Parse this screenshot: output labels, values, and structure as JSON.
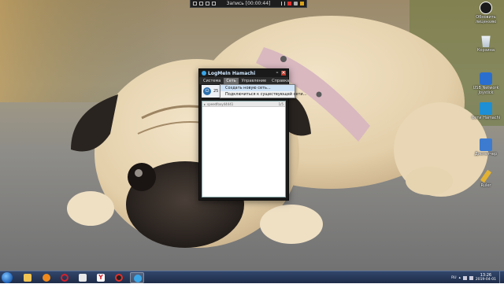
{
  "recorder": {
    "title": "Запись [00:00:44]"
  },
  "desktop_icons": [
    {
      "label": "Обновить лицензию",
      "icon": "update-license-icon",
      "color": "#1a1a1a"
    },
    {
      "label": "Корзина",
      "icon": "recycle-bin-icon",
      "color": "#d0d8e0"
    },
    {
      "label": "USB Network Joystick",
      "icon": "usb-joystick-icon",
      "color": "#2a6fd0"
    },
    {
      "label": "Сети Hamachi",
      "icon": "hamachi-network-icon",
      "color": "#1e8fd5"
    },
    {
      "label": "Диспетчер",
      "icon": "device-manager-icon",
      "color": "#3d7bd0"
    },
    {
      "label": "Ruler",
      "icon": "ruler-icon",
      "color": "#e3b232"
    }
  ],
  "hamachi": {
    "title": "LogMeIn Hamachi",
    "menu": [
      "Система",
      "Сеть",
      "Управление",
      "Справка"
    ],
    "active_menu": "Сеть",
    "status_text": "25",
    "network_row": {
      "name": "speedfoxy44441",
      "count": "1/5"
    }
  },
  "dropdown": {
    "options": [
      "Создать новую сеть...",
      "Подключиться к существующей сети..."
    ]
  },
  "taskbar": {
    "apps": [
      {
        "name": "explorer",
        "icon": "folder-icon",
        "color": "#f1c453"
      },
      {
        "name": "media-player",
        "icon": "media-player-icon",
        "color": "#f08a1c"
      },
      {
        "name": "opera",
        "icon": "opera-icon",
        "color": "#d3212d"
      },
      {
        "name": "notes",
        "icon": "notepad-icon",
        "color": "#e8e8e8"
      },
      {
        "name": "yandex",
        "icon": "yandex-browser-icon",
        "color": "#ffffff"
      },
      {
        "name": "recorder",
        "icon": "recorder-icon",
        "color": "#e0302b"
      },
      {
        "name": "hamachi",
        "icon": "hamachi-icon",
        "color": "#3aa6e8"
      }
    ],
    "language": "RU",
    "time": "13:26",
    "date": "2019-04-01"
  }
}
